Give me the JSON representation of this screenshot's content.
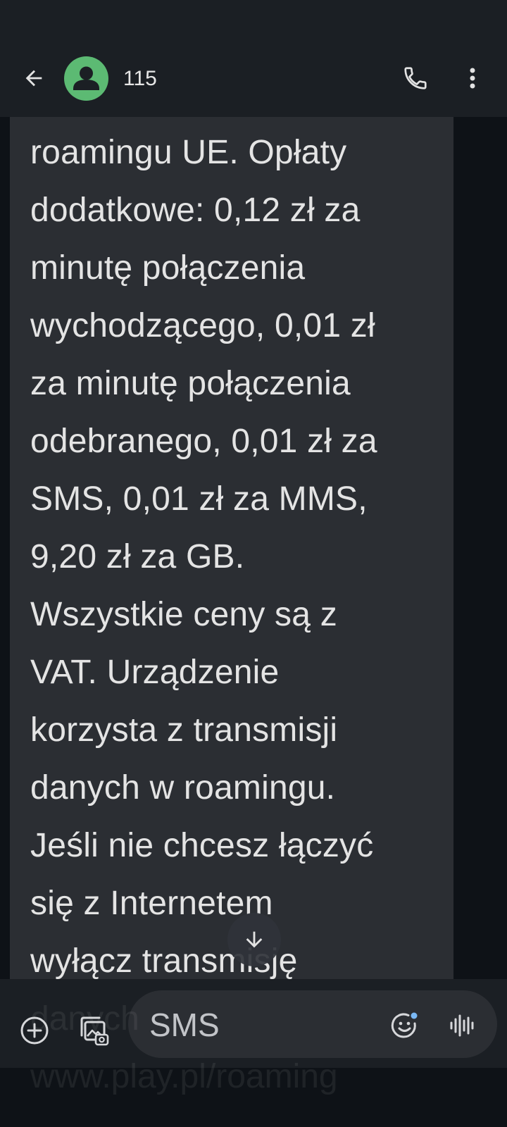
{
  "header": {
    "contact_name": "115",
    "back_icon": "arrow-back-icon",
    "avatar_icon": "person-icon",
    "call_icon": "phone-icon",
    "more_icon": "more-vert-icon"
  },
  "message": {
    "text": "roamingu UE. Opłaty\ndodatkowe: 0,12 zł za\nminutę połączenia\nwychodzącego, 0,01 zł\nza minutę połączenia\nodebranego, 0,01 zł za\nSMS, 0,01 zł za MMS,\n9,20 zł za GB.\nWszystkie ceny są z\nVAT. Urządzenie\nkorzysta z transmisji\ndanych w roamingu.\nJeśli nie chcesz łączyć\nsię z Internetem\nwyłącz transmisję",
    "overflow_lines": [
      "danych",
      "www.play.pl/roaming"
    ],
    "scroll_icon": "arrow-down-icon"
  },
  "compose": {
    "placeholder": "SMS",
    "add_icon": "add-circle-icon",
    "gallery_icon": "gallery-icon",
    "emoji_icon": "emoji-icon",
    "voice_icon": "voice-waveform-icon"
  },
  "colors": {
    "avatar": "#5cba73",
    "bubble": "#2b2e33",
    "bar": "#1b1f24",
    "background": "#0e1217",
    "accent_dot": "#7ab8f5"
  }
}
